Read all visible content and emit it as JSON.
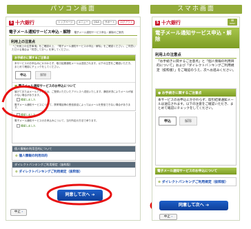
{
  "captions": {
    "pc": "パソコン画面",
    "sp": "スマホ画面"
  },
  "pc": {
    "bank_name": "十六銀行",
    "tabs": [
      "トップページ",
      "メニュー",
      "Q&A",
      "サポート",
      "ログアウト"
    ],
    "title": "電子メール通知サービス申込・解除",
    "header_lines": "電子メール通知サービス申込・解除のご案内",
    "section_title": "利用上の注意点",
    "intro": "「ご利用上の注意事項」をご確認の上、「電子メール通知サービスの申込・解除」をご確認ください。ご同意いただける場合は「同意して次へ」を押してください。",
    "box_title": "お手続きに関するご注意点",
    "box_text": "本サービスのお申込みにかかわらず、取引結果通知メールは送信されます。以下の注意をご確認いただき、まとめて確認にチェックをしてください。",
    "apply_label": "申込",
    "cancel_label": "解除",
    "notice_title": "電子メール通知サービスのお申込について",
    "items": [
      "届けてまたはメールアドレスは、ご登録いただいたアドレスへ送信いたします。通信状況によりメールが届かない場合があります。",
      "電子メール通知サービスについて、携帯電話等の受信設定によってはメールを受信できない場合があります。",
      "電子メール通知サービスのお申込みについて、当行所定の方法で承ります。"
    ],
    "check_label": "確認しました",
    "personal_title": "個人情報の利用目的について",
    "personal_link": "個人情報の利用目的",
    "direct_title": "ダイレクトバンキングご利用規定（抜粋版）",
    "direct_link": "ダイレクトバンキングご利用規定（抜粋版）",
    "agree_button": "同意して次へ",
    "stop_button": "中止"
  },
  "sp": {
    "bank_name": "十六銀行",
    "menu_label": "MENU",
    "title": "電子メール通知サービス申込・解除",
    "section_title": "利用上の注意点",
    "intro": "「お手続きに関するご注意点」と「個人情報の利用目的について」および「ダイレクトバンキングご利用規定（抜粋版）」をご確認のうえ、次へお進みください。",
    "box_title": "お手続きに関するご注意点",
    "box_text": "本サービスのお申込にかかわらず、取引結果通知メールは送信されます。以下の注意をご確認いただき、まとめて確認にチェックをしてください。",
    "apply_label": "申込",
    "cancel_label": "解除",
    "notice_title": "電子メール通知サービスのお申込について",
    "direct_link": "ダイレクトバンキングご利用規定（抜粋版）",
    "agree_button": "同意して次へ",
    "stop_button": "中止"
  },
  "colors": {
    "accent_green": "#92ab3a",
    "bank_red": "#c8132b",
    "button_blue": "#1449b0",
    "highlight_red": "#e81010"
  }
}
